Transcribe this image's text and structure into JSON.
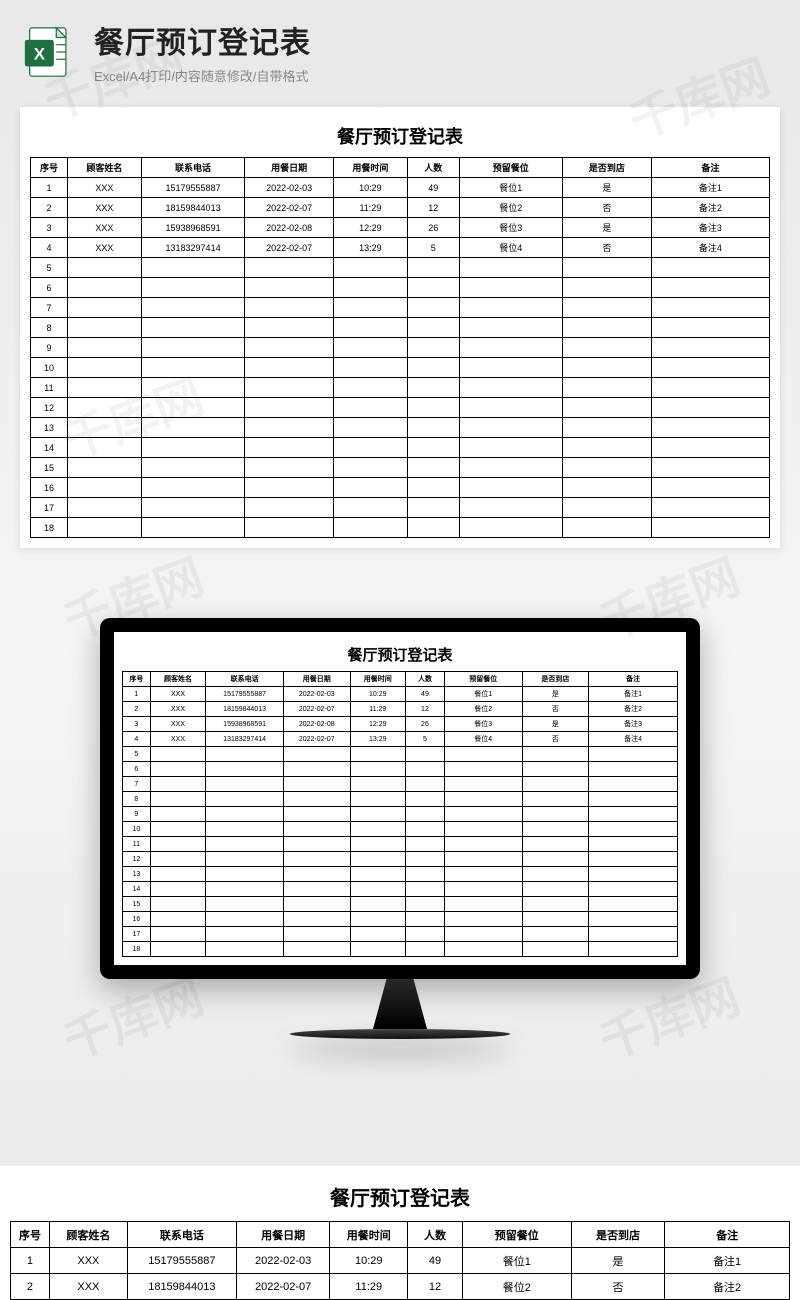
{
  "header": {
    "title": "餐厅预订登记表",
    "subtitle": "Excel/A4打印/内容随意修改/自带格式"
  },
  "table": {
    "title": "餐厅预订登记表",
    "columns": [
      "序号",
      "顾客姓名",
      "联系电话",
      "用餐日期",
      "用餐时间",
      "人数",
      "预留餐位",
      "是否到店",
      "备注"
    ],
    "rows": [
      {
        "idx": "1",
        "name": "XXX",
        "phone": "15179555887",
        "date": "2022-02-03",
        "time": "10:29",
        "count": "49",
        "seat": "餐位1",
        "arrive": "是",
        "note": "备注1"
      },
      {
        "idx": "2",
        "name": "XXX",
        "phone": "18159844013",
        "date": "2022-02-07",
        "time": "11:29",
        "count": "12",
        "seat": "餐位2",
        "arrive": "否",
        "note": "备注2"
      },
      {
        "idx": "3",
        "name": "XXX",
        "phone": "15938968591",
        "date": "2022-02-08",
        "time": "12:29",
        "count": "26",
        "seat": "餐位3",
        "arrive": "是",
        "note": "备注3"
      },
      {
        "idx": "4",
        "name": "XXX",
        "phone": "13183297414",
        "date": "2022-02-07",
        "time": "13:29",
        "count": "5",
        "seat": "餐位4",
        "arrive": "否",
        "note": "备注4"
      }
    ],
    "empty_rows": [
      "5",
      "6",
      "7",
      "8",
      "9",
      "10",
      "11",
      "12",
      "13",
      "14",
      "15",
      "16",
      "17",
      "18"
    ]
  },
  "watermark_text": "千库网",
  "bottom_visible_rows": 2
}
